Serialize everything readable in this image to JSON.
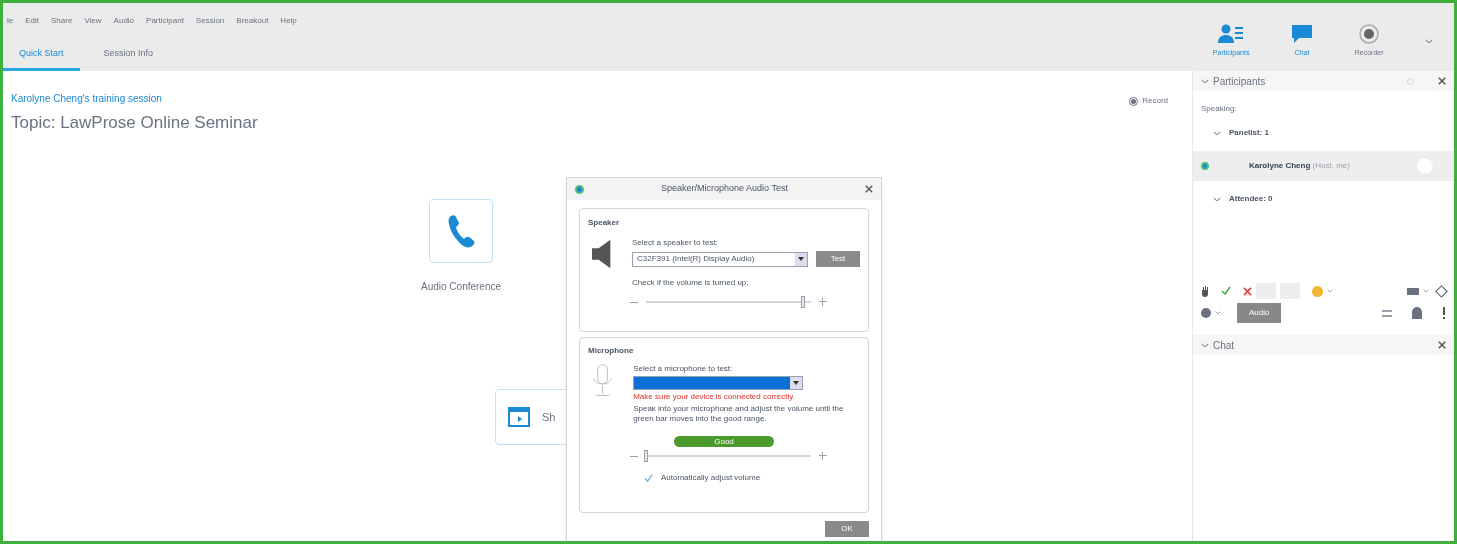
{
  "menu": [
    "le",
    "Edit",
    "Share",
    "View",
    "Audio",
    "Participant",
    "Session",
    "Breakout",
    "Help"
  ],
  "tabs": [
    {
      "label": "Quick Start",
      "selected": true
    },
    {
      "label": "Session Info",
      "selected": false
    }
  ],
  "session": {
    "host_line": "Karolyne Cheng's training session",
    "topic": "Topic: LawProse Online Seminar",
    "record": "Record"
  },
  "actions": [
    {
      "kind": "phone",
      "label": "Audio Conference"
    },
    {
      "kind": "share",
      "label": "Sh"
    }
  ],
  "panel_tabs": [
    {
      "kind": "participants",
      "label": "Participants",
      "selected": true
    },
    {
      "kind": "chat",
      "label": "Chat",
      "selected": true
    },
    {
      "kind": "recorder",
      "label": "Recorder",
      "selected": false
    }
  ],
  "participants": {
    "title": "Participants",
    "speaking": "Speaking:",
    "groups": [
      {
        "label": "Panelist: 1",
        "expanded": true,
        "members": [
          {
            "name": "Karolyne Cheng",
            "role": "(Host, me)",
            "selected": true
          }
        ]
      },
      {
        "label": "Attendee: 0",
        "expanded": true
      }
    ],
    "audio_button": "Audio"
  },
  "chat": {
    "title": "Chat"
  },
  "dialog": {
    "title": "Speaker/Microphone Audio Test",
    "speaker": {
      "heading": "Speaker",
      "select_label": "Select a speaker to test:",
      "device": "C32F391 (Intel(R) Display Audio)",
      "test_button": "Test",
      "hint": "Check if the volume is turned up:",
      "level": 0.95
    },
    "microphone": {
      "heading": "Microphone",
      "select_label": "Select a microphone to test:",
      "error": "Make sure your device is connected correctly.",
      "instructions": "Speak into your microphone and adjust the volume until the green bar moves into the good range.",
      "meter": "Good",
      "level": 0,
      "auto_adjust": {
        "label": "Automatically adjust volume",
        "checked": true
      }
    },
    "ok_button": "OK"
  }
}
